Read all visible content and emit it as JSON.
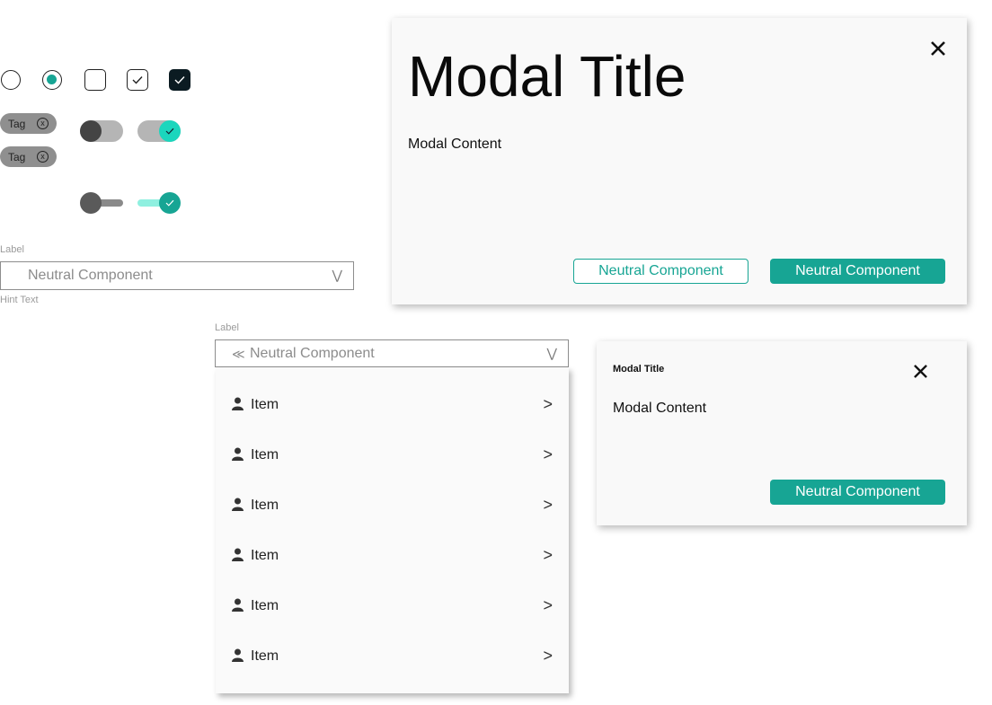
{
  "tags": [
    {
      "label": "Tag"
    },
    {
      "label": "Tag"
    }
  ],
  "select1": {
    "label": "Label",
    "value": "Neutral Component",
    "hint": "Hint Text"
  },
  "select2": {
    "label": "Label",
    "value": "Neutral Component"
  },
  "menu_items": [
    {
      "label": "Item"
    },
    {
      "label": "Item"
    },
    {
      "label": "Item"
    },
    {
      "label": "Item"
    },
    {
      "label": "Item"
    },
    {
      "label": "Item"
    }
  ],
  "modal_large": {
    "title": "Modal Title",
    "content": "Modal Content",
    "secondary_button": "Neutral Component",
    "primary_button": "Neutral Component"
  },
  "modal_small": {
    "title": "Modal Title",
    "content": "Modal Content",
    "primary_button": "Neutral Component"
  },
  "colors": {
    "accent": "#17a594",
    "accent_light": "#8ff0e0",
    "toggle_teal": "#1bd6bd",
    "dark": "#0b1b22"
  }
}
